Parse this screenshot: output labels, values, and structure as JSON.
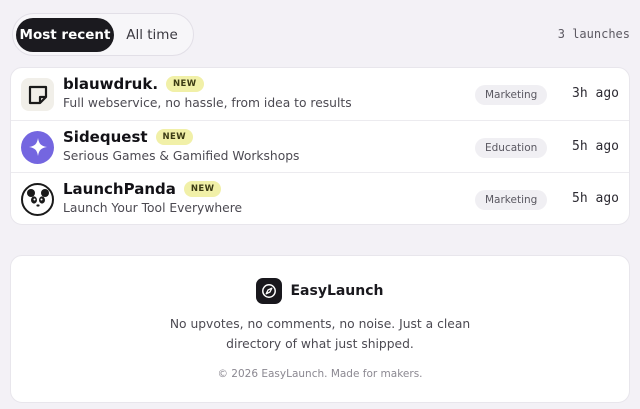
{
  "filters": {
    "most_recent": "Most recent",
    "all_time": "All time"
  },
  "launch_count": "3 launches",
  "launches": [
    {
      "name": "blauwdruk.",
      "badge": "NEW",
      "description": "Full webservice, no hassle, from idea to results",
      "category": "Marketing",
      "time": "3h ago",
      "icon": "blueprint-square-icon"
    },
    {
      "name": "Sidequest",
      "badge": "NEW",
      "description": "Serious Games & Gamified Workshops",
      "category": "Education",
      "time": "5h ago",
      "icon": "sparkle-star-icon"
    },
    {
      "name": "LaunchPanda",
      "badge": "NEW",
      "description": "Launch Your Tool Everywhere",
      "category": "Marketing",
      "time": "5h ago",
      "icon": "panda-icon"
    }
  ],
  "footer": {
    "brand": "EasyLaunch",
    "tagline_line1": "No upvotes, no comments, no noise. Just a clean",
    "tagline_line2": "directory of what just shipped.",
    "copyright": "© 2026 EasyLaunch. Made for makers."
  },
  "colors": {
    "background": "#f3f1f6",
    "active_toggle": "#1b1a1f",
    "badge_bg": "#f1f0a8",
    "sidequest_purple": "#7466e0"
  }
}
